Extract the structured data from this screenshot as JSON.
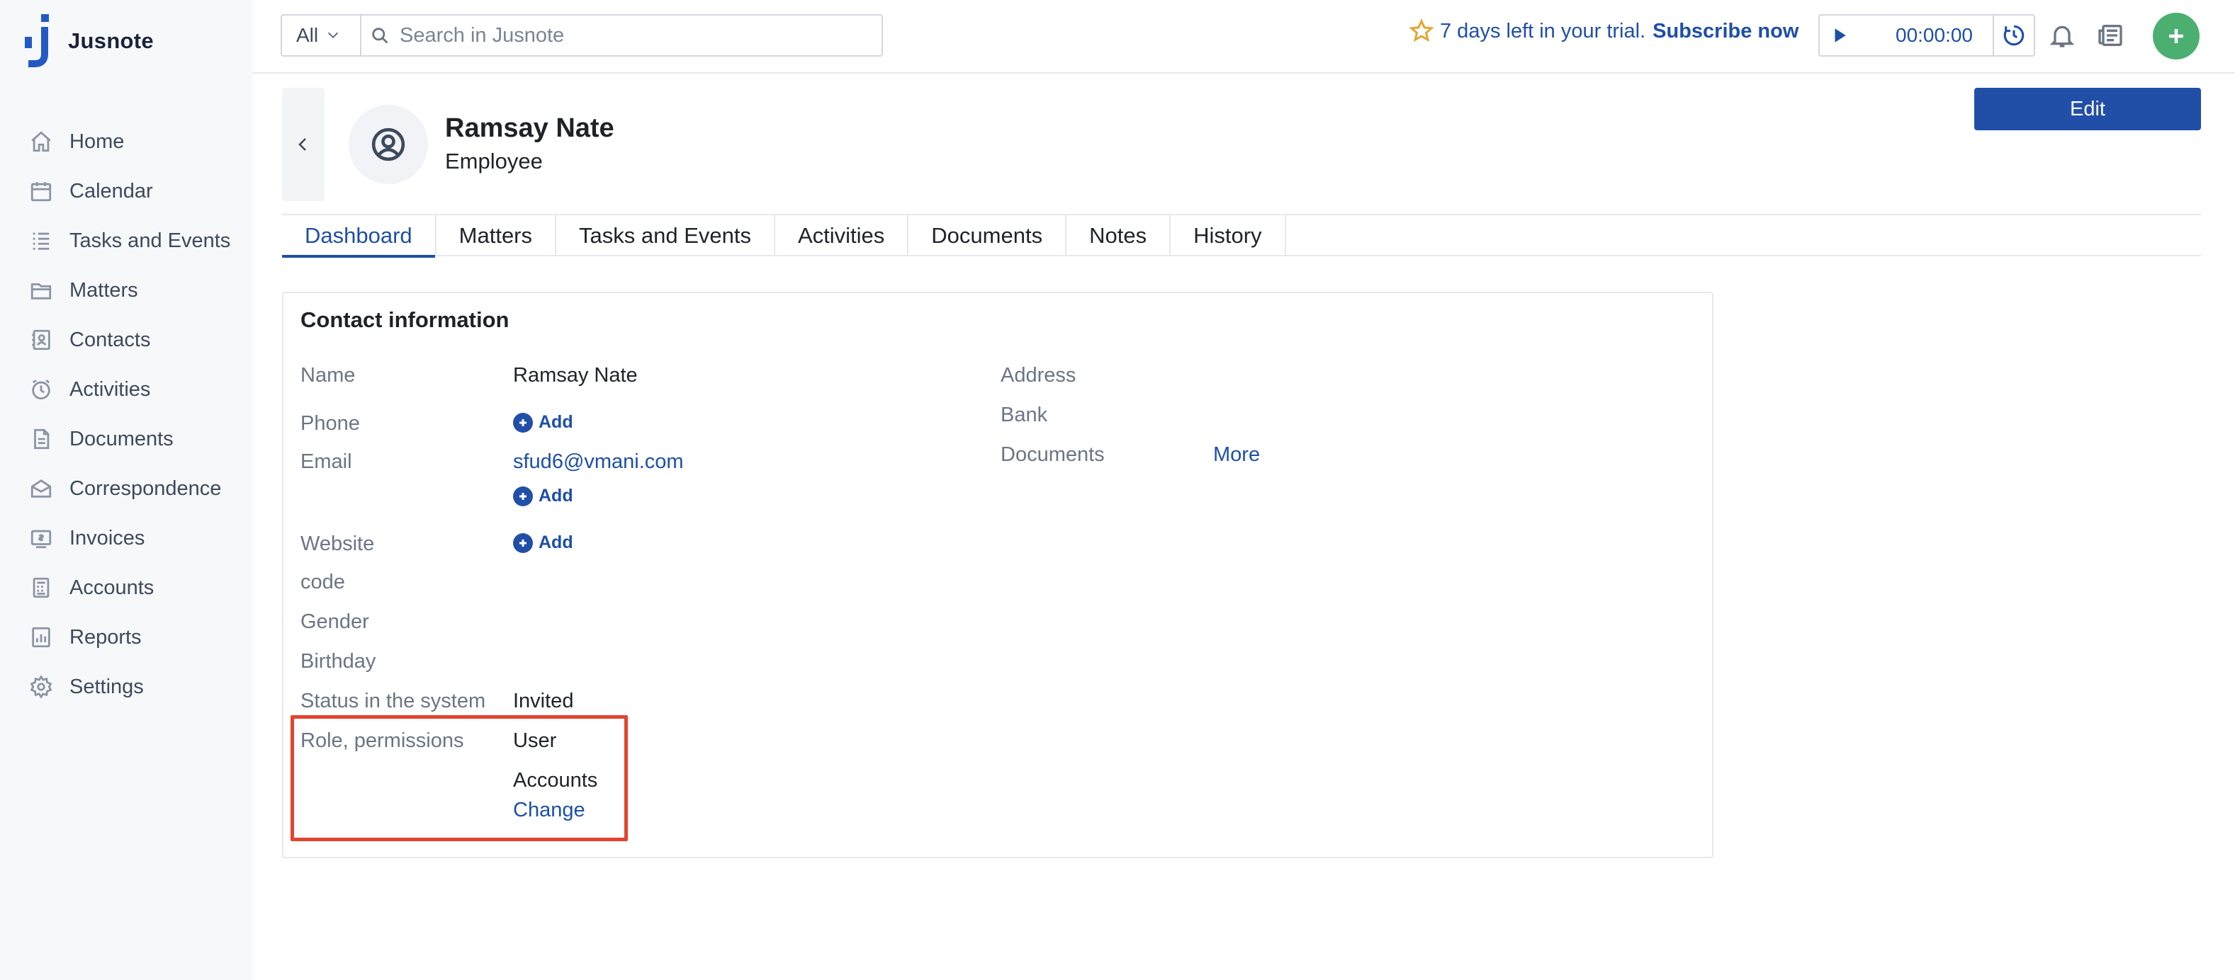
{
  "app": {
    "name": "Jusnote"
  },
  "sidebar": {
    "items": [
      {
        "label": "Home",
        "icon": "home-icon"
      },
      {
        "label": "Calendar",
        "icon": "calendar-icon"
      },
      {
        "label": "Tasks and Events",
        "icon": "tasks-icon"
      },
      {
        "label": "Matters",
        "icon": "matters-icon"
      },
      {
        "label": "Contacts",
        "icon": "contacts-icon"
      },
      {
        "label": "Activities",
        "icon": "activities-icon"
      },
      {
        "label": "Documents",
        "icon": "documents-icon"
      },
      {
        "label": "Correspondence",
        "icon": "correspondence-icon"
      },
      {
        "label": "Invoices",
        "icon": "invoices-icon"
      },
      {
        "label": "Accounts",
        "icon": "accounts-icon"
      },
      {
        "label": "Reports",
        "icon": "reports-icon"
      },
      {
        "label": "Settings",
        "icon": "gear-icon"
      }
    ]
  },
  "topbar": {
    "search_scope": "All",
    "search_placeholder": "Search in Jusnote",
    "trial_text": "7 days left in your trial.",
    "subscribe_label": "Subscribe now",
    "timer": "00:00:00"
  },
  "profile": {
    "name": "Ramsay Nate",
    "role": "Employee",
    "edit_label": "Edit"
  },
  "tabs": [
    {
      "label": "Dashboard",
      "active": true
    },
    {
      "label": "Matters",
      "active": false
    },
    {
      "label": "Tasks and Events",
      "active": false
    },
    {
      "label": "Activities",
      "active": false
    },
    {
      "label": "Documents",
      "active": false
    },
    {
      "label": "Notes",
      "active": false
    },
    {
      "label": "History",
      "active": false
    }
  ],
  "contact_info": {
    "title": "Contact information",
    "name_label": "Name",
    "name_value": "Ramsay Nate",
    "phone_label": "Phone",
    "add_label": "Add",
    "email_label": "Email",
    "email_value": "sfud6@vmani.com",
    "website_label": "Website",
    "code_label": "code",
    "gender_label": "Gender",
    "birthday_label": "Birthday",
    "status_label": "Status in the system",
    "status_value": "Invited",
    "role_label": "Role, permissions",
    "role_value": "User",
    "permission_value": "Accounts",
    "change_label": "Change",
    "address_label": "Address",
    "bank_label": "Bank",
    "documents_label": "Documents",
    "more_label": "More"
  },
  "colors": {
    "accent": "#1e4fa8",
    "primary_button": "#214fa8",
    "create_button": "#4caf72",
    "highlight": "#e2442f",
    "trial_star": "#e3a735"
  }
}
